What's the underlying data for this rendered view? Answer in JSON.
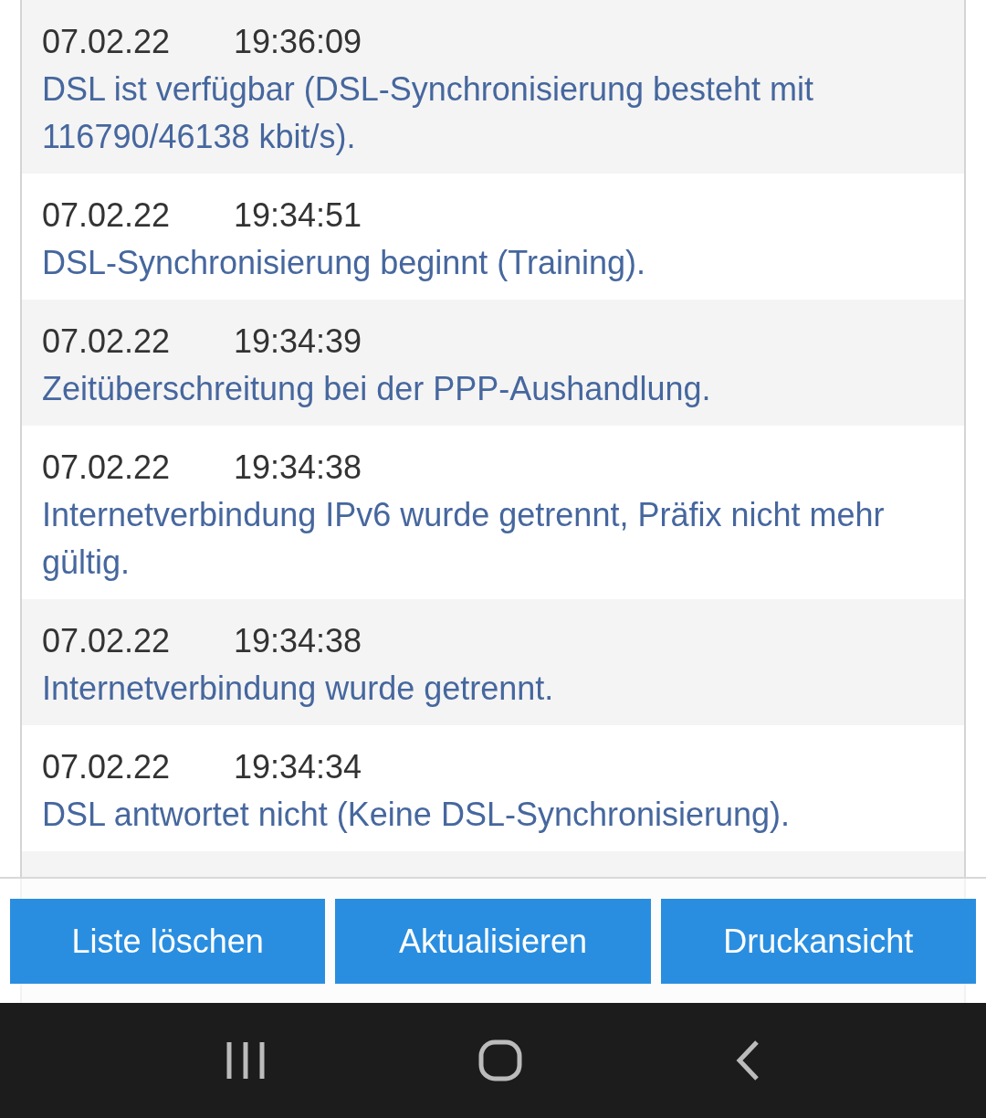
{
  "events": [
    {
      "date": "07.02.22",
      "time": "19:36:09",
      "message": "DSL ist verfügbar (DSL-Synchronisierung besteht mit 116790/46138 kbit/s)."
    },
    {
      "date": "07.02.22",
      "time": "19:34:51",
      "message": "DSL-Synchronisierung beginnt (Training)."
    },
    {
      "date": "07.02.22",
      "time": "19:34:39",
      "message": "Zeitüberschreitung bei der PPP-Aushandlung."
    },
    {
      "date": "07.02.22",
      "time": "19:34:38",
      "message": "Internetverbindung IPv6 wurde getrennt, Präfix nicht mehr gültig."
    },
    {
      "date": "07.02.22",
      "time": "19:34:38",
      "message": "Internetverbindung wurde getrennt."
    },
    {
      "date": "07.02.22",
      "time": "19:34:34",
      "message": "DSL antwortet nicht (Keine DSL-Synchronisierung)."
    }
  ],
  "buttons": [
    "Liste löschen",
    "Aktualisieren",
    "Druckansicht"
  ]
}
